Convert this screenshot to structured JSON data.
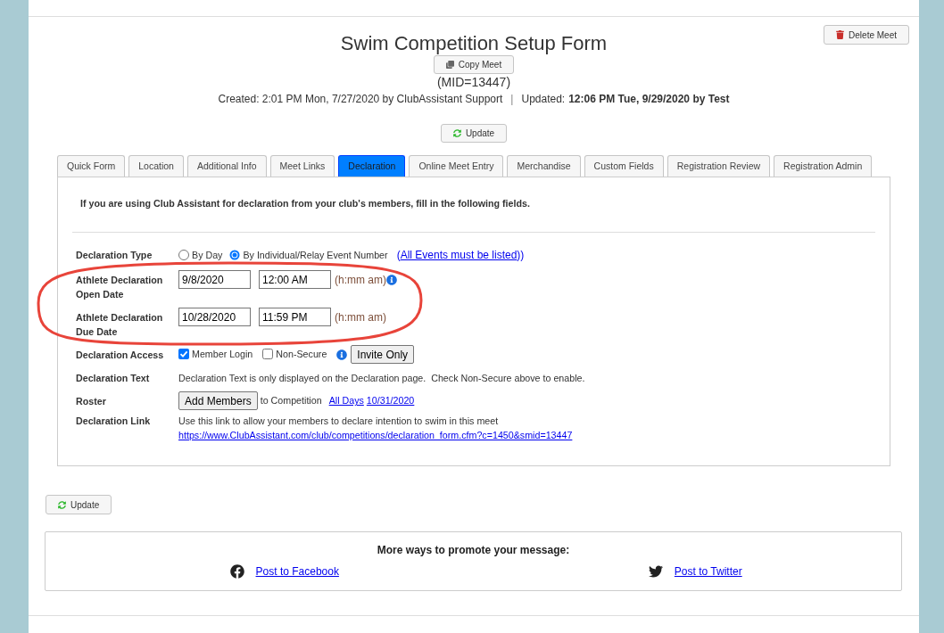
{
  "header": {
    "title": "Swim Competition Setup Form",
    "copy_button": "Copy Meet",
    "meet_id": "(MID=13447)",
    "created": "Created: 2:01 PM Mon, 7/27/2020 by ClubAssistant Support",
    "separator": "|",
    "updated_label": "Updated:",
    "updated_value": "12:06 PM Tue, 9/29/2020 by Test",
    "update_button": "Update",
    "delete_button": "Delete Meet"
  },
  "tabs": [
    {
      "label": "Quick Form",
      "selected": false
    },
    {
      "label": "Location",
      "selected": false
    },
    {
      "label": "Additional Info",
      "selected": false
    },
    {
      "label": "Meet Links",
      "selected": false
    },
    {
      "label": "Declaration",
      "selected": true
    },
    {
      "label": "Online Meet Entry",
      "selected": false
    },
    {
      "label": "Merchandise",
      "selected": false
    },
    {
      "label": "Custom Fields",
      "selected": false
    },
    {
      "label": "Registration Review",
      "selected": false
    },
    {
      "label": "Registration Admin",
      "selected": false
    }
  ],
  "declaration": {
    "intro": "If you are using Club Assistant for declaration from your club's members, fill in the following fields.",
    "rows": [
      {
        "kind": "radio",
        "label": "Declaration Type",
        "options": [
          {
            "label": "By Day",
            "selected": false
          },
          {
            "label": "By Individual/Relay Event Number",
            "selected": true
          }
        ],
        "note_open": "(",
        "note_link": "All Events must be listed",
        "note_close": "))"
      },
      {
        "kind": "datetime",
        "label": "Athlete Declaration Open Date",
        "date": "9/8/2020",
        "time": "12:00 AM",
        "format_hint": "(h:mm am)",
        "info": true
      },
      {
        "kind": "datetime",
        "label": "Athlete Declaration Due Date",
        "date": "10/28/2020",
        "time": "11:59 PM",
        "format_hint": "(h:mm am)"
      },
      {
        "kind": "access",
        "label": "Declaration Access",
        "options": [
          {
            "label": "Member Login",
            "checked": true
          },
          {
            "label": "Non-Secure",
            "checked": false
          }
        ],
        "info": true,
        "button": "Invite Only"
      },
      {
        "kind": "text",
        "label": "Declaration Text",
        "text": "Declaration Text is only displayed on the Declaration page.  Check Non-Secure above to enable."
      },
      {
        "kind": "roster",
        "label": "Roster",
        "button": "Add Members",
        "text": "to Competition",
        "links": [
          "All Days",
          "10/31/2020"
        ]
      },
      {
        "kind": "link",
        "label": "Declaration Link",
        "text": "Use this link to allow your members to declare intention to swim in this meet",
        "url": "https://www.ClubAssistant.com/club/competitions/declaration_form.cfm?c=1450&smid=13447"
      }
    ]
  },
  "footer_update_button": "Update",
  "promote": {
    "title": "More ways to promote your message:",
    "links": [
      {
        "kind": "facebook",
        "label": "Post to Facebook"
      },
      {
        "kind": "twitter",
        "label": "Post to Twitter"
      }
    ]
  }
}
